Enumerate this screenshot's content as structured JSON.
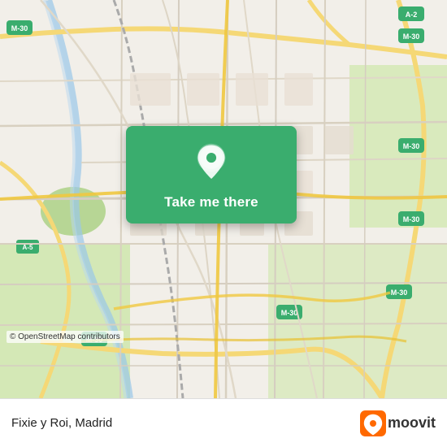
{
  "map": {
    "attribution": "© OpenStreetMap contributors"
  },
  "cta": {
    "button_label": "Take me there",
    "pin_icon": "location-pin"
  },
  "bottom_bar": {
    "place_name": "Fixie y Roi, Madrid",
    "logo_text": "moovit"
  }
}
